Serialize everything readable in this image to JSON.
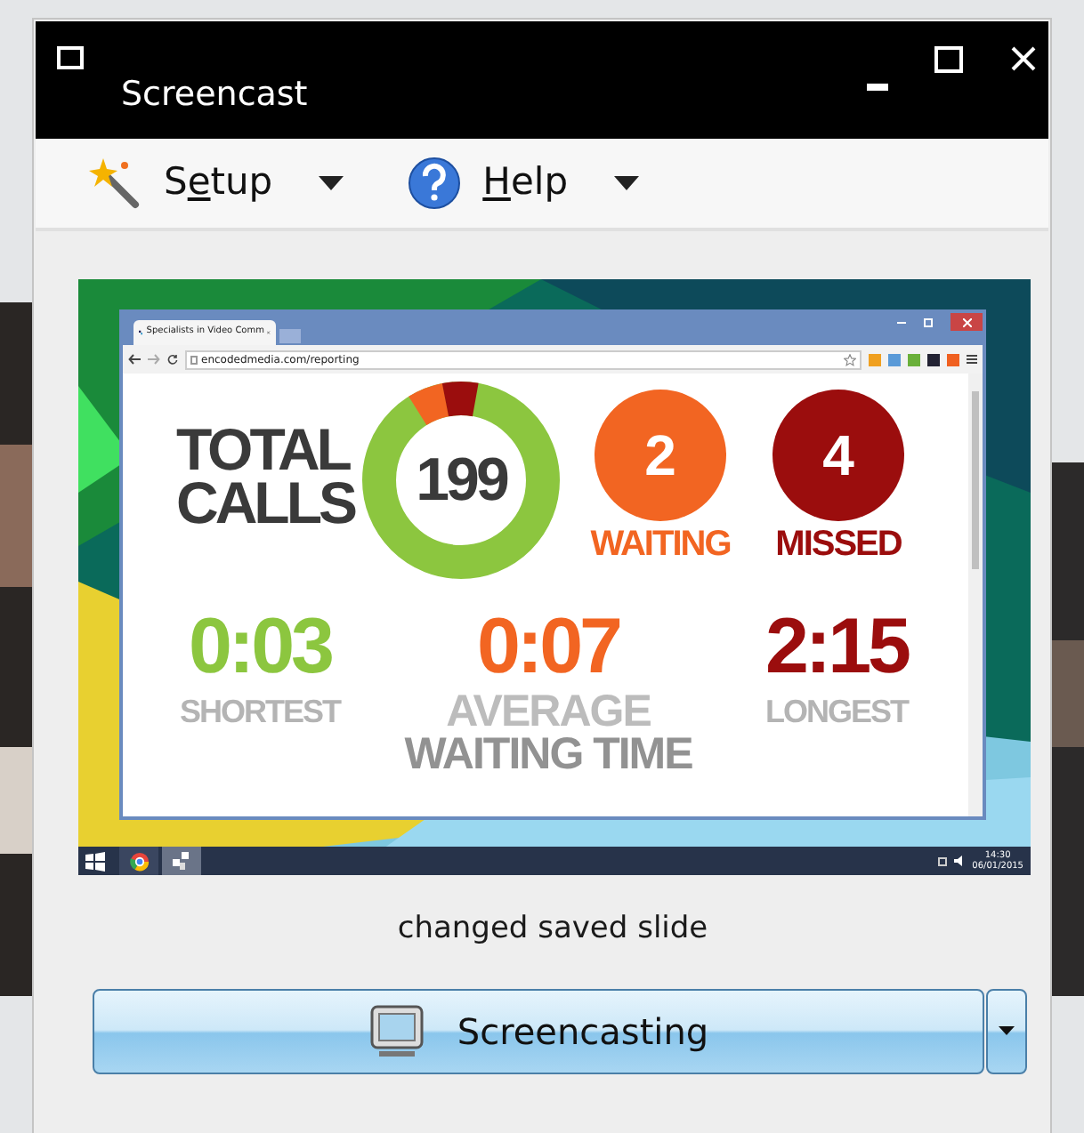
{
  "window": {
    "title": "Screencast"
  },
  "toolbar": [
    {
      "kind": "wand",
      "label_start": "S",
      "access_key": "e",
      "label_end": "tup"
    },
    {
      "kind": "help",
      "access_key": "H",
      "label_end": "elp"
    }
  ],
  "preview": {
    "browser": {
      "tab_title": "Specialists in Video Comm",
      "address": "encodedmedia.com/reporting"
    },
    "dashboard": {
      "total_lines": [
        "TOTAL",
        "CALLS"
      ],
      "total_value": "199",
      "counters": [
        {
          "value": "2",
          "label": "WAITING",
          "color": "#f26522"
        },
        {
          "value": "4",
          "label": "MISSED",
          "color": "#9b0d0d"
        }
      ],
      "times": [
        {
          "value": "0:03",
          "labels": [
            "SHORTEST"
          ],
          "color": "#8cc63f"
        },
        {
          "value": "0:07",
          "labels": [
            "AVERAGE",
            "WAITING TIME"
          ],
          "color": "#f26522"
        },
        {
          "value": "2:15",
          "labels": [
            "LONGEST"
          ],
          "color": "#9b0d0d"
        }
      ]
    },
    "taskbar": {
      "time": "14:30",
      "date": "06/01/2015"
    }
  },
  "status": "changed saved slide",
  "button": {
    "label": "Screencasting"
  }
}
